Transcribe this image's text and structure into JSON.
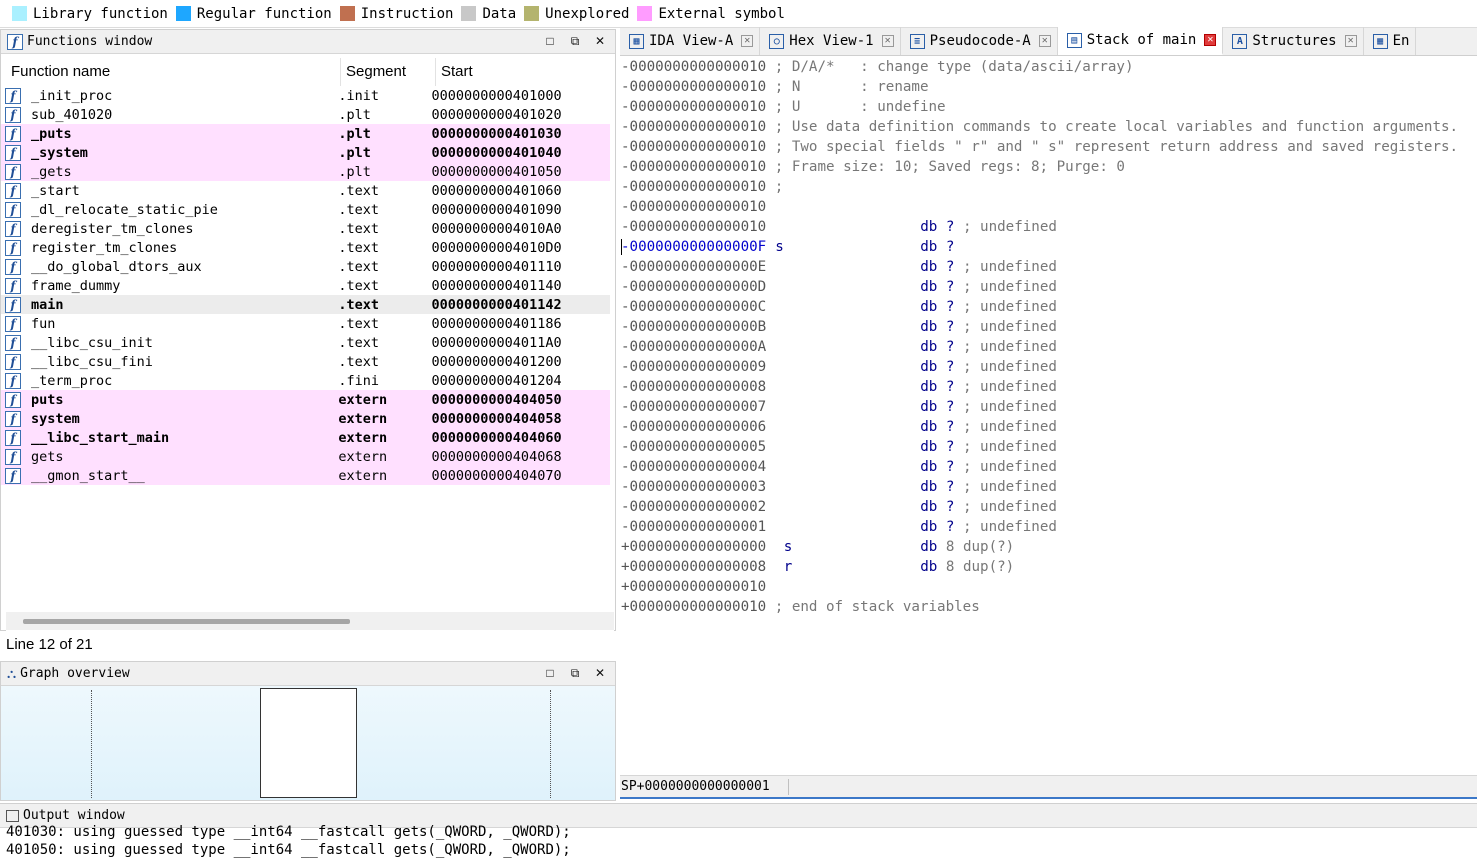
{
  "legend": [
    {
      "label": "Library function",
      "color": "#aaf0ff"
    },
    {
      "label": "Regular function",
      "color": "#1ea7ff"
    },
    {
      "label": "Instruction",
      "color": "#c07050"
    },
    {
      "label": "Data",
      "color": "#c8c8c8"
    },
    {
      "label": "Unexplored",
      "color": "#b4b46e"
    },
    {
      "label": "External symbol",
      "color": "#ff9cff"
    }
  ],
  "functions_window": {
    "title": "Functions window",
    "columns": [
      "Function name",
      "Segment",
      "Start"
    ],
    "rows": [
      {
        "name": "_init_proc",
        "segment": ".init",
        "start": "0000000000401000",
        "style": ""
      },
      {
        "name": "sub_401020",
        "segment": ".plt",
        "start": "0000000000401020",
        "style": ""
      },
      {
        "name": "_puts",
        "segment": ".plt",
        "start": "0000000000401030",
        "style": "ext bold"
      },
      {
        "name": "_system",
        "segment": ".plt",
        "start": "0000000000401040",
        "style": "ext bold"
      },
      {
        "name": "_gets",
        "segment": ".plt",
        "start": "0000000000401050",
        "style": "ext"
      },
      {
        "name": "_start",
        "segment": ".text",
        "start": "0000000000401060",
        "style": ""
      },
      {
        "name": "_dl_relocate_static_pie",
        "segment": ".text",
        "start": "0000000000401090",
        "style": ""
      },
      {
        "name": "deregister_tm_clones",
        "segment": ".text",
        "start": "00000000004010A0",
        "style": ""
      },
      {
        "name": "register_tm_clones",
        "segment": ".text",
        "start": "00000000004010D0",
        "style": ""
      },
      {
        "name": "__do_global_dtors_aux",
        "segment": ".text",
        "start": "0000000000401110",
        "style": ""
      },
      {
        "name": "frame_dummy",
        "segment": ".text",
        "start": "0000000000401140",
        "style": ""
      },
      {
        "name": "main",
        "segment": ".text",
        "start": "0000000000401142",
        "style": "sel bold"
      },
      {
        "name": "fun",
        "segment": ".text",
        "start": "0000000000401186",
        "style": ""
      },
      {
        "name": "__libc_csu_init",
        "segment": ".text",
        "start": "00000000004011A0",
        "style": ""
      },
      {
        "name": "__libc_csu_fini",
        "segment": ".text",
        "start": "0000000000401200",
        "style": ""
      },
      {
        "name": "_term_proc",
        "segment": ".fini",
        "start": "0000000000401204",
        "style": ""
      },
      {
        "name": "puts",
        "segment": "extern",
        "start": "0000000000404050",
        "style": "ext bold"
      },
      {
        "name": "system",
        "segment": "extern",
        "start": "0000000000404058",
        "style": "ext bold"
      },
      {
        "name": "__libc_start_main",
        "segment": "extern",
        "start": "0000000000404060",
        "style": "ext bold"
      },
      {
        "name": "gets",
        "segment": "extern",
        "start": "0000000000404068",
        "style": "ext"
      },
      {
        "name": "__gmon_start__",
        "segment": "extern",
        "start": "0000000000404070",
        "style": "ext"
      }
    ],
    "line_status": "Line 12 of 21"
  },
  "graph_overview": {
    "title": "Graph overview"
  },
  "tabs": [
    {
      "label": "IDA View-A",
      "icon": "ida-view-icon",
      "glyph": "▦",
      "active": false
    },
    {
      "label": "Hex View-1",
      "icon": "hex-view-icon",
      "glyph": "○",
      "active": false
    },
    {
      "label": "Pseudocode-A",
      "icon": "pseudocode-icon",
      "glyph": "≡",
      "active": false
    },
    {
      "label": "Stack of main",
      "icon": "stack-icon",
      "glyph": "▤",
      "active": true
    },
    {
      "label": "Structures",
      "icon": "structures-icon",
      "glyph": "A",
      "active": false
    },
    {
      "label": "En",
      "icon": "enums-icon",
      "glyph": "▦",
      "active": false
    }
  ],
  "stack_lines": [
    {
      "off": "-0000000000000010",
      "text": " ; D/A/*   : change type (data/ascii/array)",
      "kind": "comment"
    },
    {
      "off": "-0000000000000010",
      "text": " ; N       : rename",
      "kind": "comment"
    },
    {
      "off": "-0000000000000010",
      "text": " ; U       : undefine",
      "kind": "comment"
    },
    {
      "off": "-0000000000000010",
      "text": " ; Use data definition commands to create local variables and function arguments.",
      "kind": "comment"
    },
    {
      "off": "-0000000000000010",
      "text": " ; Two special fields \" r\" and \" s\" represent return address and saved registers.",
      "kind": "comment"
    },
    {
      "off": "-0000000000000010",
      "text": " ; Frame size: 10; Saved regs: 8; Purge: 0",
      "kind": "comment"
    },
    {
      "off": "-0000000000000010",
      "text": " ;",
      "kind": "comment"
    },
    {
      "off": "-0000000000000010",
      "text": "",
      "kind": "comment"
    },
    {
      "off": "-0000000000000010",
      "var": "",
      "db": "db",
      "val": "?",
      "cmt": " ; undefined",
      "kind": "def"
    },
    {
      "off": "-000000000000000F",
      "var": "s",
      "db": "db",
      "val": "?",
      "cmt": "",
      "kind": "def",
      "current": true
    },
    {
      "off": "-000000000000000E",
      "var": "",
      "db": "db",
      "val": "?",
      "cmt": " ; undefined",
      "kind": "def"
    },
    {
      "off": "-000000000000000D",
      "var": "",
      "db": "db",
      "val": "?",
      "cmt": " ; undefined",
      "kind": "def"
    },
    {
      "off": "-000000000000000C",
      "var": "",
      "db": "db",
      "val": "?",
      "cmt": " ; undefined",
      "kind": "def"
    },
    {
      "off": "-000000000000000B",
      "var": "",
      "db": "db",
      "val": "?",
      "cmt": " ; undefined",
      "kind": "def"
    },
    {
      "off": "-000000000000000A",
      "var": "",
      "db": "db",
      "val": "?",
      "cmt": " ; undefined",
      "kind": "def"
    },
    {
      "off": "-0000000000000009",
      "var": "",
      "db": "db",
      "val": "?",
      "cmt": " ; undefined",
      "kind": "def"
    },
    {
      "off": "-0000000000000008",
      "var": "",
      "db": "db",
      "val": "?",
      "cmt": " ; undefined",
      "kind": "def"
    },
    {
      "off": "-0000000000000007",
      "var": "",
      "db": "db",
      "val": "?",
      "cmt": " ; undefined",
      "kind": "def"
    },
    {
      "off": "-0000000000000006",
      "var": "",
      "db": "db",
      "val": "?",
      "cmt": " ; undefined",
      "kind": "def"
    },
    {
      "off": "-0000000000000005",
      "var": "",
      "db": "db",
      "val": "?",
      "cmt": " ; undefined",
      "kind": "def"
    },
    {
      "off": "-0000000000000004",
      "var": "",
      "db": "db",
      "val": "?",
      "cmt": " ; undefined",
      "kind": "def"
    },
    {
      "off": "-0000000000000003",
      "var": "",
      "db": "db",
      "val": "?",
      "cmt": " ; undefined",
      "kind": "def"
    },
    {
      "off": "-0000000000000002",
      "var": "",
      "db": "db",
      "val": "?",
      "cmt": " ; undefined",
      "kind": "def"
    },
    {
      "off": "-0000000000000001",
      "var": "",
      "db": "db",
      "val": "?",
      "cmt": " ; undefined",
      "kind": "def"
    },
    {
      "off": "+0000000000000000",
      "var": " s",
      "db": "db",
      "val": "8 dup(?)",
      "cmt": "",
      "kind": "def2"
    },
    {
      "off": "+0000000000000008",
      "var": " r",
      "db": "db",
      "val": "8 dup(?)",
      "cmt": "",
      "kind": "def2"
    },
    {
      "off": "+0000000000000010",
      "text": "",
      "kind": "comment"
    },
    {
      "off": "+0000000000000010",
      "text": " ; end of stack variables",
      "kind": "comment"
    }
  ],
  "sp_status": "SP+0000000000000001",
  "output_window": {
    "title": "Output window",
    "lines": [
      "401030: using guessed type __int64 __fastcall gets(_QWORD, _QWORD);",
      "401050: using guessed type __int64 __fastcall gets(_QWORD, _QWORD);"
    ]
  }
}
